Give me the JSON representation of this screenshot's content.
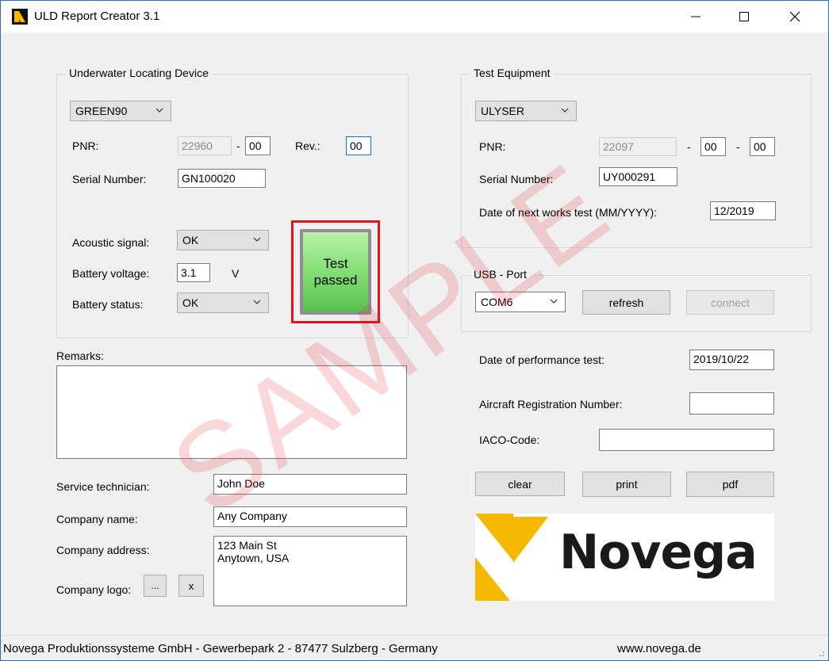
{
  "window": {
    "title": "ULD Report Creator 3.1",
    "controls": {
      "minimize": "—",
      "maximize": "☐",
      "close": "✕"
    }
  },
  "uld": {
    "group_label": "Underwater Locating Device",
    "model": "GREEN90",
    "pnr_label": "PNR:",
    "pnr": "22960",
    "pnr_dash": "-",
    "pnr_suffix": "00",
    "rev_label": "Rev.:",
    "rev": "00",
    "serial_label": "Serial Number:",
    "serial": "GN100020",
    "acoustic_label": "Acoustic signal:",
    "acoustic": "OK",
    "voltage_label": "Battery voltage:",
    "voltage": "3.1",
    "voltage_unit": "V",
    "battery_status_label": "Battery status:",
    "battery_status": "OK",
    "test_line1": "Test",
    "test_line2": "passed"
  },
  "equipment": {
    "group_label": "Test Equipment",
    "model": "ULYSER",
    "pnr_label": "PNR:",
    "pnr": "22097",
    "pnr_dash": "-",
    "pnr_mid": "00",
    "pnr_dash2": "-",
    "pnr_end": "00",
    "serial_label": "Serial Number:",
    "serial": "UY000291",
    "next_test_label": "Date of next works test (MM/YYYY):",
    "next_test": "12/2019"
  },
  "usb": {
    "group_label": "USB - Port",
    "port": "COM6",
    "refresh": "refresh",
    "connect": "connect"
  },
  "report": {
    "perf_date_label": "Date of performance test:",
    "perf_date": "2019/10/22",
    "aircraft_label": "Aircraft Registration Number:",
    "aircraft": "",
    "iaco_label": "IACO-Code:",
    "iaco": "",
    "clear": "clear",
    "print": "print",
    "pdf": "pdf"
  },
  "remarks": {
    "label": "Remarks:",
    "value": ""
  },
  "company": {
    "technician_label": "Service technician:",
    "technician": "John Doe",
    "name_label": "Company name:",
    "name": "Any Company",
    "address_label": "Company address:",
    "address_line1": "123 Main St",
    "address_line2": "Anytown, USA",
    "logo_label": "Company logo:",
    "browse": "...",
    "remove": "x"
  },
  "logo_text": "Novega",
  "watermark": "SAMPLE",
  "statusbar": {
    "address": "Novega Produktionssysteme GmbH - Gewerbepark 2 - 87477 Sulzberg - Germany",
    "website": "www.novega.de"
  },
  "colors": {
    "accent": "#0078d7",
    "status_frame": "#e0141c",
    "status_green": "#57c24e",
    "logo_yellow": "#f5b800",
    "watermark": "#e62832"
  },
  "icons": [
    "app-icon",
    "chevron-down-icon",
    "minimize-icon",
    "maximize-icon",
    "close-icon",
    "resize-grip-icon"
  ]
}
